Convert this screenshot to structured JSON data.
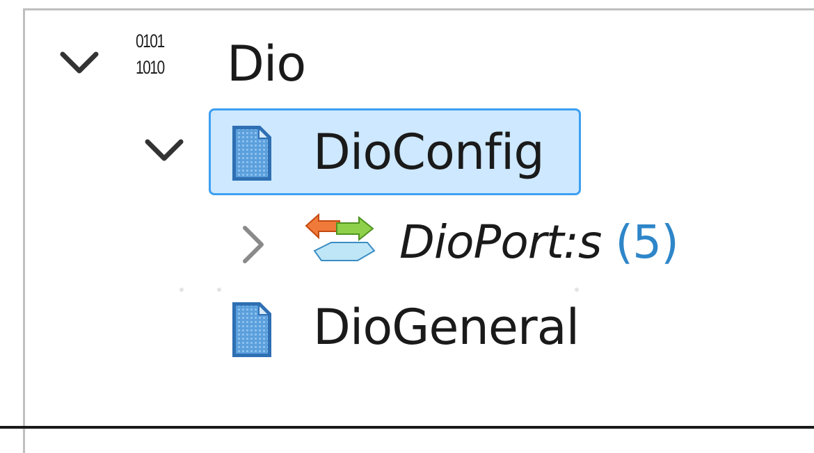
{
  "tree": {
    "root": {
      "label": "Dio",
      "expanded": true,
      "icon": "binary-module-icon",
      "icon_lines": [
        "0101",
        "1010"
      ]
    },
    "config": {
      "label": "DioConfig",
      "expanded": true,
      "selected": true,
      "icon": "container-document-icon"
    },
    "ports": {
      "label": "DioPort:s",
      "count": "(5)",
      "expanded": false,
      "icon": "port-list-icon"
    },
    "general": {
      "label": "DioGeneral",
      "icon": "container-document-icon"
    }
  },
  "colors": {
    "selection_fill": "#cde8ff",
    "selection_border": "#3d9ff1",
    "count_text": "#2e86c9",
    "doc_icon_blue": "#4f94d4"
  }
}
